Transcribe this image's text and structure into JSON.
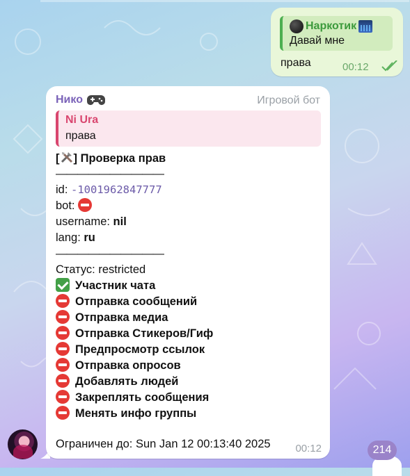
{
  "outgoing": {
    "reply_name": "Наркотик",
    "reply_text": "Давай мне",
    "text": "права",
    "time": "00:12"
  },
  "incoming": {
    "sender": "Нико",
    "badge": "Игровой бот",
    "reply_name": "Ni Ura",
    "reply_text": "права",
    "header": "Проверка прав",
    "divider": "——————————",
    "id_label": "id: ",
    "id_value": "-1001962847777",
    "bot_label": "bot: ",
    "username_label": "username: ",
    "username_value": "nil",
    "lang_label": "lang: ",
    "lang_value": "ru",
    "status_label": "Статус: ",
    "status_value": "restricted",
    "permissions": [
      {
        "label": "Участник чата",
        "state": "ok"
      },
      {
        "label": "Отправка сообщений",
        "state": "no"
      },
      {
        "label": "Отправка медиа",
        "state": "no"
      },
      {
        "label": "Отправка Стикеров/Гиф",
        "state": "no"
      },
      {
        "label": "Предпросмотр ссылок",
        "state": "no"
      },
      {
        "label": "Отправка опросов",
        "state": "no"
      },
      {
        "label": "Добавлять людей",
        "state": "no"
      },
      {
        "label": "Закреплять сообщения",
        "state": "no"
      },
      {
        "label": "Менять инфо группы",
        "state": "no"
      }
    ],
    "restricted_until": "Ограничен до: Sun Jan 12 00:13:40 2025",
    "time": "00:12"
  },
  "unread_count": "214",
  "colors": {
    "outgoing_bubble": "#e9f7d9",
    "incoming_bubble": "#ffffff",
    "sender_name": "#7a62b8",
    "reply_accent": "#d9466f",
    "unread_badge": "#9a83c9"
  }
}
